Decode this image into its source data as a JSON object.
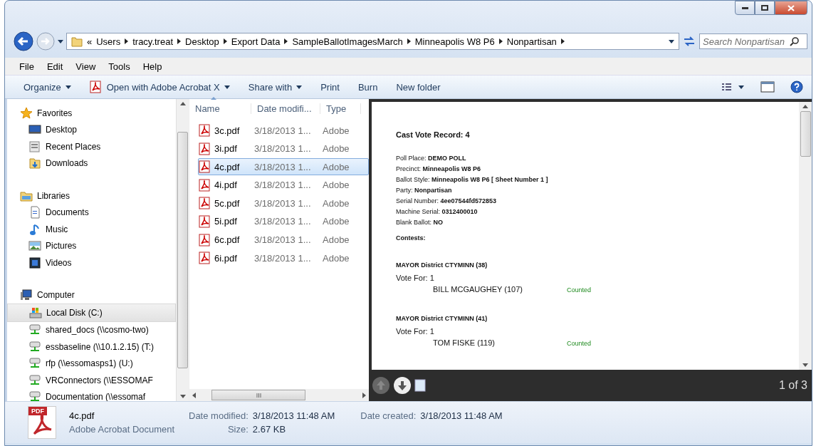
{
  "address_bar": {
    "overflow": "«",
    "breadcrumb": [
      "Users",
      "tracy.treat",
      "Desktop",
      "Export Data",
      "SampleBallotImagesMarch",
      "Minneapolis W8 P6",
      "Nonpartisan"
    ]
  },
  "search": {
    "placeholder": "Search Nonpartisan"
  },
  "menu": [
    "File",
    "Edit",
    "View",
    "Tools",
    "Help"
  ],
  "toolbar": [
    {
      "label": "Organize",
      "dropdown": true
    },
    {
      "label": "Open with Adobe Acrobat X",
      "dropdown": true
    },
    {
      "label": "Share with",
      "dropdown": true
    },
    {
      "label": "Print",
      "dropdown": false
    },
    {
      "label": "Burn",
      "dropdown": false
    },
    {
      "label": "New folder",
      "dropdown": false
    }
  ],
  "navigation": [
    {
      "label": "Favorites",
      "selected": false,
      "children": [
        {
          "label": "Desktop",
          "selected": false
        },
        {
          "label": "Recent Places",
          "selected": false
        },
        {
          "label": "Downloads",
          "selected": false
        }
      ]
    },
    {
      "label": "Libraries",
      "selected": false,
      "children": [
        {
          "label": "Documents",
          "selected": false
        },
        {
          "label": "Music",
          "selected": false
        },
        {
          "label": "Pictures",
          "selected": false
        },
        {
          "label": "Videos",
          "selected": false
        }
      ]
    },
    {
      "label": "Computer",
      "selected": false,
      "children": [
        {
          "label": "Local Disk (C:)",
          "selected": true
        },
        {
          "label": "shared_docs (\\\\cosmo-two)",
          "selected": false
        },
        {
          "label": "essbaseline (\\\\10.1.2.15) (T:)",
          "selected": false
        },
        {
          "label": "rfp (\\\\essomasps1) (U:)",
          "selected": false
        },
        {
          "label": "VRConnectors (\\\\ESSOMAF",
          "selected": false
        },
        {
          "label": "Documentation (\\\\essomaf",
          "selected": false
        }
      ]
    }
  ],
  "file_list": {
    "columns": [
      "Name",
      "Date modifi...",
      "Type"
    ],
    "rows": [
      {
        "name": "3c.pdf",
        "date": "3/18/2013 1...",
        "type": "Adobe",
        "selected": false
      },
      {
        "name": "3i.pdf",
        "date": "3/18/2013 1...",
        "type": "Adobe",
        "selected": false
      },
      {
        "name": "4c.pdf",
        "date": "3/18/2013 1...",
        "type": "Adobe",
        "selected": true
      },
      {
        "name": "4i.pdf",
        "date": "3/18/2013 1...",
        "type": "Adobe",
        "selected": false
      },
      {
        "name": "5c.pdf",
        "date": "3/18/2013 1...",
        "type": "Adobe",
        "selected": false
      },
      {
        "name": "5i.pdf",
        "date": "3/18/2013 1...",
        "type": "Adobe",
        "selected": false
      },
      {
        "name": "6c.pdf",
        "date": "3/18/2013 1...",
        "type": "Adobe",
        "selected": false
      },
      {
        "name": "6i.pdf",
        "date": "3/18/2013 1...",
        "type": "Adobe",
        "selected": false
      }
    ]
  },
  "preview": {
    "title": "Cast Vote Record: 4",
    "fields": [
      "Poll Place: **DEMO POLL**",
      "Precinct: **Minneapolis W8 P6**",
      "Ballot Style: **Minneapolis W8 P6 [ Sheet Number 1 ]**",
      "Party: **Nonpartisan**",
      "Serial Number: **4ee07544fd572853**",
      "Machine Serial: **0312400010**",
      "Blank Ballot: **NO**"
    ],
    "contests_heading": "Contests:",
    "contests": [
      {
        "title": "MAYOR District CTYMINN (38)",
        "vote_for": "Vote For: 1",
        "candidate": "BILL MCGAUGHEY (107)",
        "status": "Counted"
      },
      {
        "title": "MAYOR District CTYMINN (41)",
        "vote_for": "Vote For: 1",
        "candidate": "TOM FISKE (119)",
        "status": "Counted"
      }
    ],
    "page": "1 of 3"
  },
  "details": {
    "name": "4c.pdf",
    "type": "Adobe Acrobat Document",
    "fields": [
      {
        "label": "Date modified:",
        "value": "3/18/2013 11:48 AM"
      },
      {
        "label": "Size:",
        "value": "2.67 KB"
      },
      {
        "label": "Date created:",
        "value": "3/18/2013 11:48 AM"
      }
    ],
    "badge": "PDF"
  }
}
